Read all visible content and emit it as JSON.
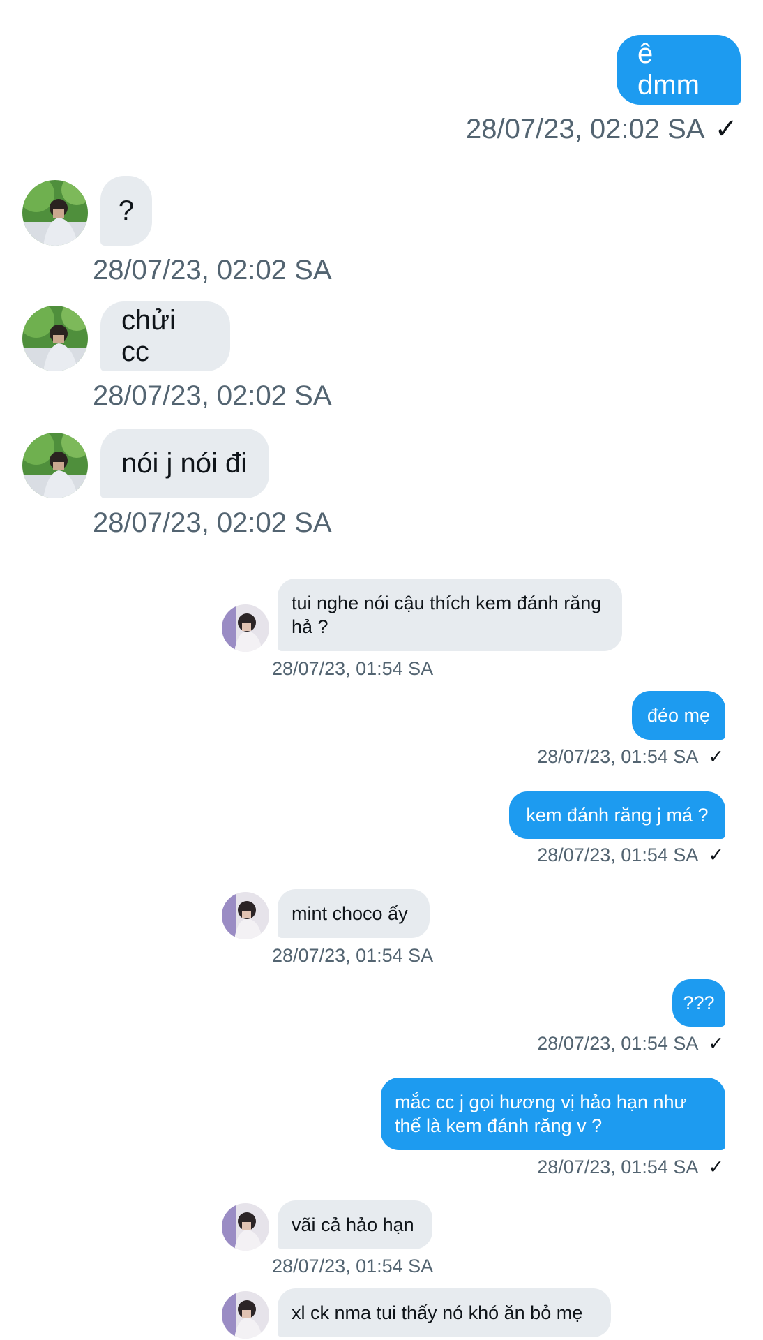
{
  "conversation_top": {
    "messages": [
      {
        "direction": "outgoing",
        "text": "ê dmm",
        "time": "28/07/23, 02:02 SA",
        "check": "✓"
      },
      {
        "direction": "incoming",
        "text": "?",
        "time": "28/07/23, 02:02 SA"
      },
      {
        "direction": "incoming",
        "text": "chửi cc",
        "time": "28/07/23, 02:02 SA"
      },
      {
        "direction": "incoming",
        "text": "nói j nói đi",
        "time": "28/07/23, 02:02 SA"
      }
    ]
  },
  "conversation_embedded": {
    "messages": [
      {
        "direction": "incoming",
        "text": "tui nghe nói cậu thích kem đánh răng hả ?",
        "time": "28/07/23, 01:54 SA"
      },
      {
        "direction": "outgoing",
        "text": "đéo mẹ",
        "time": "28/07/23, 01:54 SA",
        "check": "✓"
      },
      {
        "direction": "outgoing",
        "text": "kem đánh răng j má ?",
        "time": "28/07/23, 01:54 SA",
        "check": "✓"
      },
      {
        "direction": "incoming",
        "text": "mint choco ấy",
        "time": "28/07/23, 01:54 SA"
      },
      {
        "direction": "outgoing",
        "text": "???",
        "time": "28/07/23, 01:54 SA",
        "check": "✓"
      },
      {
        "direction": "outgoing",
        "text": "mắc cc j gọi hương vị hảo hạn như thế là kem đánh răng v ?",
        "time": "28/07/23, 01:54 SA",
        "check": "✓"
      },
      {
        "direction": "incoming",
        "text": "vãi cả hảo hạn",
        "time": "28/07/23, 01:54 SA"
      },
      {
        "direction": "incoming",
        "text": "xl ck nma tui thấy nó khó ăn bỏ mẹ"
      }
    ]
  },
  "colors": {
    "outgoing_bubble": "#1d9bf0",
    "incoming_bubble": "#e7ebef",
    "timestamp": "#536471"
  },
  "icons": {
    "read_receipt": "check-icon",
    "avatar_top": "avatar-photo",
    "avatar_embedded": "avatar-photo"
  }
}
